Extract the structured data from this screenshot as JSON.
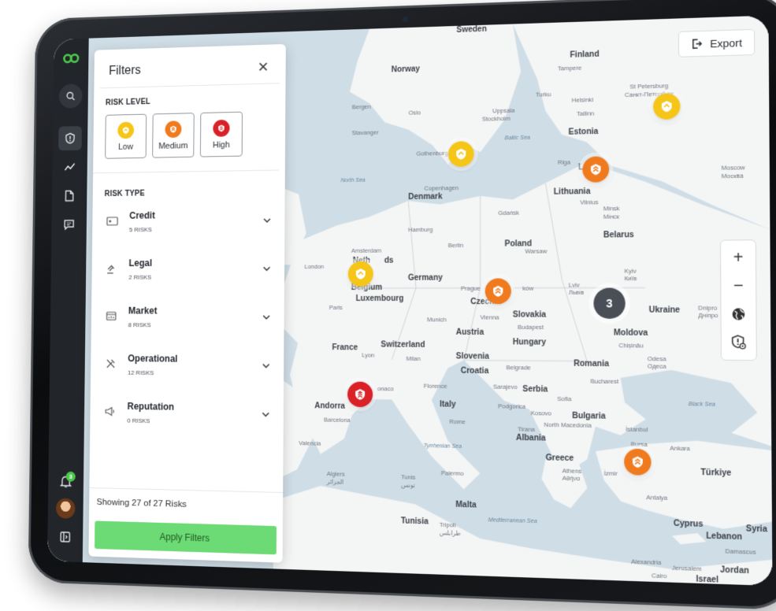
{
  "colors": {
    "rail_bg": "#22252a",
    "brand_green": "#4cc84a",
    "risk_low": "#f5c518",
    "risk_medium": "#f07a1e",
    "risk_high": "#d92127",
    "apply_button": "#6ddb75",
    "cluster": "#4a4f57"
  },
  "rail": {
    "icons": [
      "logo-icon",
      "search-icon",
      "shield-icon",
      "trend-icon",
      "document-icon",
      "chat-icon"
    ],
    "bottom": {
      "notifications_badge": "3",
      "icons": [
        "bell-icon",
        "avatar",
        "sidebar-toggle-icon"
      ]
    }
  },
  "filters": {
    "title": "Filters",
    "risk_level": {
      "label": "RISK LEVEL",
      "options": [
        {
          "label": "Low",
          "level": "low"
        },
        {
          "label": "Medium",
          "level": "medium"
        },
        {
          "label": "High",
          "level": "high"
        }
      ]
    },
    "risk_type": {
      "label": "RISK TYPE",
      "items": [
        {
          "name": "Credit",
          "count": "5 RISKS",
          "icon": "credit-card-icon"
        },
        {
          "name": "Legal",
          "count": "2 RISKS",
          "icon": "gavel-icon"
        },
        {
          "name": "Market",
          "count": "8 RISKS",
          "icon": "market-icon"
        },
        {
          "name": "Operational",
          "count": "12 RISKS",
          "icon": "tools-icon"
        },
        {
          "name": "Reputation",
          "count": "0 RISKS",
          "icon": "megaphone-icon"
        }
      ]
    },
    "showing": "Showing 27 of 27 Risks",
    "apply_label": "Apply Filters"
  },
  "map": {
    "export_label": "Export",
    "controls": [
      "zoom-in-icon",
      "zoom-out-icon",
      "globe-icon",
      "risk-layer-icon"
    ],
    "cluster_count": "3",
    "pins": [
      {
        "level": "low",
        "near": "St Petersburg"
      },
      {
        "level": "low",
        "near": "Gothenburg"
      },
      {
        "level": "medium",
        "near": "Riga"
      },
      {
        "level": "low",
        "near": "Netherlands"
      },
      {
        "level": "medium",
        "near": "Kraków"
      },
      {
        "level": "high",
        "near": "Monaco"
      },
      {
        "level": "medium",
        "near": "İzmir"
      }
    ],
    "labels": {
      "sweden": "Sweden",
      "finland": "Finland",
      "norway": "Norway",
      "tampere": "Tampere",
      "turku": "Turku",
      "helsinki": "Helsinki",
      "st_petersburg": "St Petersburg",
      "st_petersburg_ru": "Санкт-Петербург",
      "bergen": "Bergen",
      "oslo": "Oslo",
      "uppsala": "Uppsala",
      "stockholm": "Stockholm",
      "tallinn": "Tallinn",
      "estonia": "Estonia",
      "stavanger": "Stavanger",
      "baltic_sea": "Baltic Sea",
      "gothenburg": "Gothenburg",
      "riga": "Riga",
      "latvia": "Lat",
      "moscow": "Moscow",
      "moscow_ru": "Москва",
      "north_sea": "North Sea",
      "copenhagen": "Copenhagen",
      "denmark": "Denmark",
      "lithuania": "Lithuania",
      "vilnius": "Vilnius",
      "gdansk": "Gdańsk",
      "minsk": "Minsk",
      "minsk_ru": "Мінск",
      "hamburg": "Hamburg",
      "belarus": "Belarus",
      "amsterdam": "Amsterdam",
      "netherlands": "Neth",
      "netherlands_end": "ds",
      "berlin": "Berlin",
      "poland": "Poland",
      "warsaw": "Warsaw",
      "london": "London",
      "germany": "Germany",
      "belgium": "Belgium",
      "prague": "Prague",
      "krakow": "ków",
      "lviv": "Lviv",
      "lviv_ua": "Львів",
      "kyiv": "Kyiv",
      "kyiv_ua": "Київ",
      "luxembourg": "Luxembourg",
      "czechia": "Czechia",
      "paris": "Paris",
      "ukraine": "Ukraine",
      "dnipro": "Dnipro",
      "dnipro_ua": "Дніпро",
      "munich": "Munich",
      "vienna": "Vienna",
      "slovakia": "Slovakia",
      "austria": "Austria",
      "budapest": "Budapest",
      "moldova": "Moldova",
      "chisinau": "Chișinău",
      "france": "France",
      "switzerland": "Switzerland",
      "hungary": "Hungary",
      "lyon": "Lyon",
      "milan": "Milan",
      "slovenia": "Slovenia",
      "odesa": "Odesa",
      "odesa_ua": "Одеса",
      "croatia": "Croatia",
      "belgrade": "Belgrade",
      "romania": "Romania",
      "monaco": "onaco",
      "florence": "Florence",
      "sarajevo": "Sarajevo",
      "serbia": "Serbia",
      "bucharest": "Bucharest",
      "andorra": "Andorra",
      "italy": "Italy",
      "sofia": "Sofia",
      "bulgaria": "Bulgaria",
      "black_sea": "Black Sea",
      "barcelona": "Barcelona",
      "kosovo": "Kosovo",
      "rome": "Rome",
      "podgorica": "Podgorica",
      "north_macedonia": "North Macedonia",
      "istanbul": "İstanbul",
      "tirana": "Tirana",
      "albania": "Albania",
      "bursa": "Bursa",
      "ankara": "Ankara",
      "valencia": "Valencia",
      "tyrrhenian_sea": "Tyrrhenian Sea",
      "greece": "Greece",
      "athens": "Athens",
      "athens_gr": "Αθήνα",
      "izmir": "İzmir",
      "turkiye": "Türkiye",
      "algiers": "Algiers",
      "algiers_ar": "الجزائر",
      "tunis": "Tunis",
      "tunis_ar": "تونس",
      "palermo": "Palermo",
      "antalya": "Antalya",
      "malta": "Malta",
      "cyprus": "Cyprus",
      "syria": "Syria",
      "tunisia": "Tunisia",
      "tripoli": "Tripoli",
      "tripoli_ar": "طرابلس",
      "mediterranean_sea": "Mediterranean Sea",
      "lebanon": "Lebanon",
      "damascus": "Damascus",
      "alexandria": "Alexandria",
      "jerusalem": "Jerusalem",
      "jordan": "Jordan",
      "cairo": "Cairo",
      "israel": "Israel"
    }
  }
}
